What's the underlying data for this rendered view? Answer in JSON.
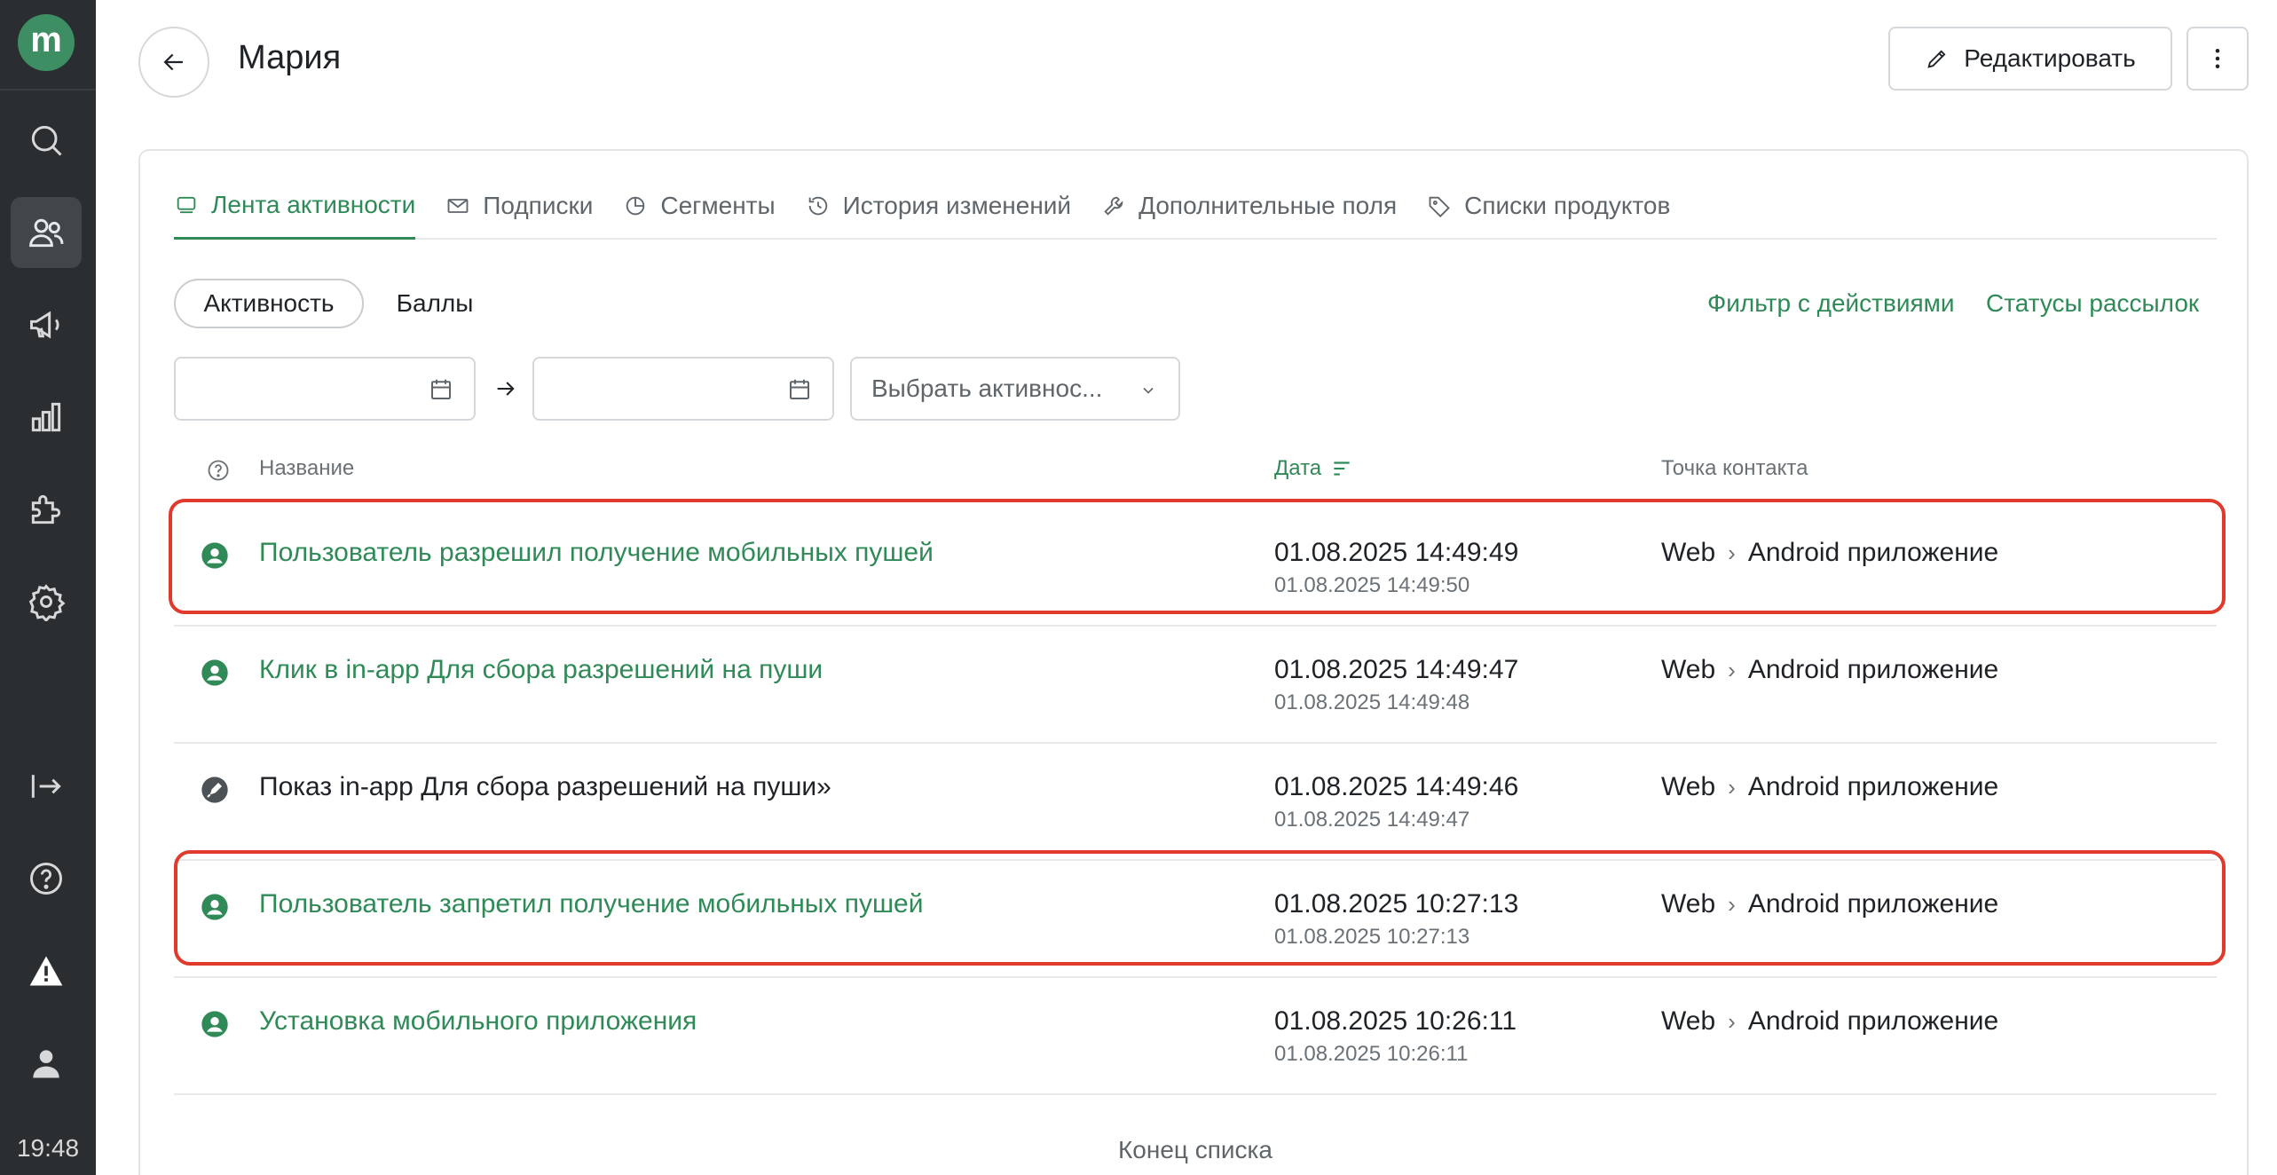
{
  "sidebar": {
    "logo_text": "m",
    "time": "19:48",
    "items": [
      {
        "icon": "search-icon"
      },
      {
        "icon": "users-icon"
      },
      {
        "icon": "megaphone-icon"
      },
      {
        "icon": "chart-icon"
      },
      {
        "icon": "puzzle-icon"
      },
      {
        "icon": "gear-icon"
      },
      {
        "icon": "logout-icon"
      },
      {
        "icon": "help-icon"
      },
      {
        "icon": "warning-icon"
      },
      {
        "icon": "user-icon"
      }
    ]
  },
  "header": {
    "title": "Мария",
    "edit_label": "Редактировать"
  },
  "tabs": [
    {
      "label": "Лента активности",
      "active": true
    },
    {
      "label": "Подписки"
    },
    {
      "label": "Сегменты"
    },
    {
      "label": "История изменений"
    },
    {
      "label": "Дополнительные поля"
    },
    {
      "label": "Списки продуктов"
    }
  ],
  "filters": {
    "chip_active": "Активность",
    "chip_other": "Баллы",
    "link_actions": "Фильтр с действиями",
    "link_statuses": "Статусы рассылок",
    "select_placeholder": "Выбрать активнос..."
  },
  "table": {
    "headers": {
      "name": "Название",
      "date": "Дата",
      "contact": "Точка контакта"
    },
    "rows": [
      {
        "name": "Пользователь разрешил получение мобильных пушей",
        "date": "01.08.2025 14:49:49",
        "date2": "01.08.2025 14:49:50",
        "from": "Web",
        "to": "Android приложение",
        "highlighted": true
      },
      {
        "name": "Клик в in-app Для сбора разрешений на пуши",
        "date": "01.08.2025 14:49:47",
        "date2": "01.08.2025 14:49:48",
        "from": "Web",
        "to": "Android приложение"
      },
      {
        "name": "Показ in-app Для сбора разрешений на пуши»",
        "date": "01.08.2025 14:49:46",
        "date2": "01.08.2025 14:49:47",
        "from": "Web",
        "to": "Android приложение"
      },
      {
        "name": "Пользователь запретил получение мобильных пушей",
        "date": "01.08.2025 10:27:13",
        "date2": "01.08.2025 10:27:13",
        "from": "Web",
        "to": "Android приложение",
        "highlighted": true
      },
      {
        "name": "Установка мобильного приложения",
        "date": "01.08.2025 10:26:11",
        "date2": "01.08.2025 10:26:11",
        "from": "Web",
        "to": "Android приложение"
      }
    ],
    "end_label": "Конец списка"
  },
  "colors": {
    "accent": "#2f8a57",
    "highlight": "#e03a2c",
    "sidebar": "#2b2e30"
  }
}
